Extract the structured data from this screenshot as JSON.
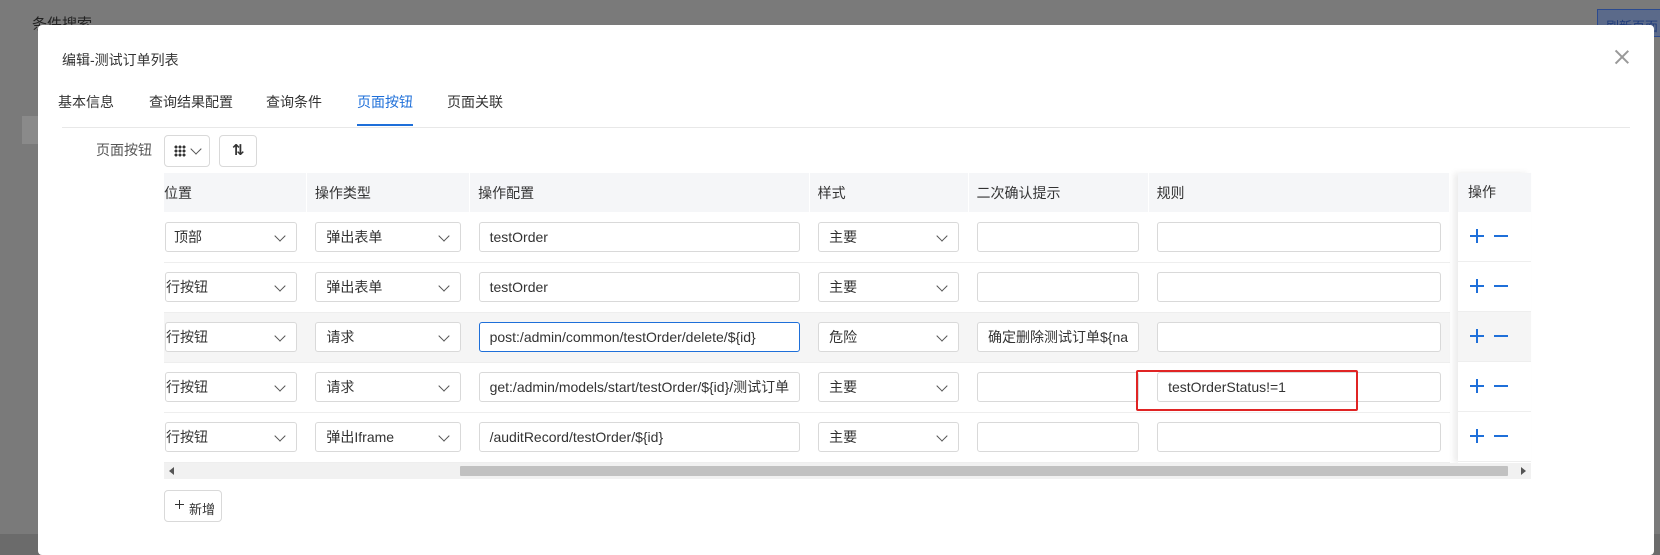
{
  "background": {
    "title": "条件搜索",
    "refresh_button": "刷新页面"
  },
  "modal": {
    "title": "编辑-测试订单列表",
    "tabs": [
      {
        "label": "基本信息"
      },
      {
        "label": "查询结果配置"
      },
      {
        "label": "查询条件"
      },
      {
        "label": "页面按钮",
        "active": true
      },
      {
        "label": "页面关联"
      }
    ],
    "section_label": "页面按钮",
    "table": {
      "headers": [
        "位置",
        "操作类型",
        "操作配置",
        "样式",
        "二次确认提示",
        "规则",
        "操作"
      ],
      "rows": [
        {
          "position": "顶部",
          "op_type": "弹出表单",
          "op_config": "testOrder",
          "style": "主要",
          "confirm": "",
          "rule": ""
        },
        {
          "position": "行按钮",
          "op_type": "弹出表单",
          "op_config": "testOrder",
          "style": "主要",
          "confirm": "",
          "rule": ""
        },
        {
          "position": "行按钮",
          "op_type": "请求",
          "op_config": "post:/admin/common/testOrder/delete/${id}",
          "style": "危险",
          "confirm": "确定删除测试订单${na",
          "rule": ""
        },
        {
          "position": "行按钮",
          "op_type": "请求",
          "op_config": "get:/admin/models/start/testOrder/${id}/测试订单",
          "style": "主要",
          "confirm": "",
          "rule": "testOrderStatus!=1"
        },
        {
          "position": "行按钮",
          "op_type": "弹出Iframe",
          "op_config": "/auditRecord/testOrder/${id}",
          "style": "主要",
          "confirm": "",
          "rule": ""
        }
      ]
    },
    "add_button": "新增"
  },
  "colors": {
    "accent": "#1e6fd9",
    "highlight_box": "#e02424"
  }
}
